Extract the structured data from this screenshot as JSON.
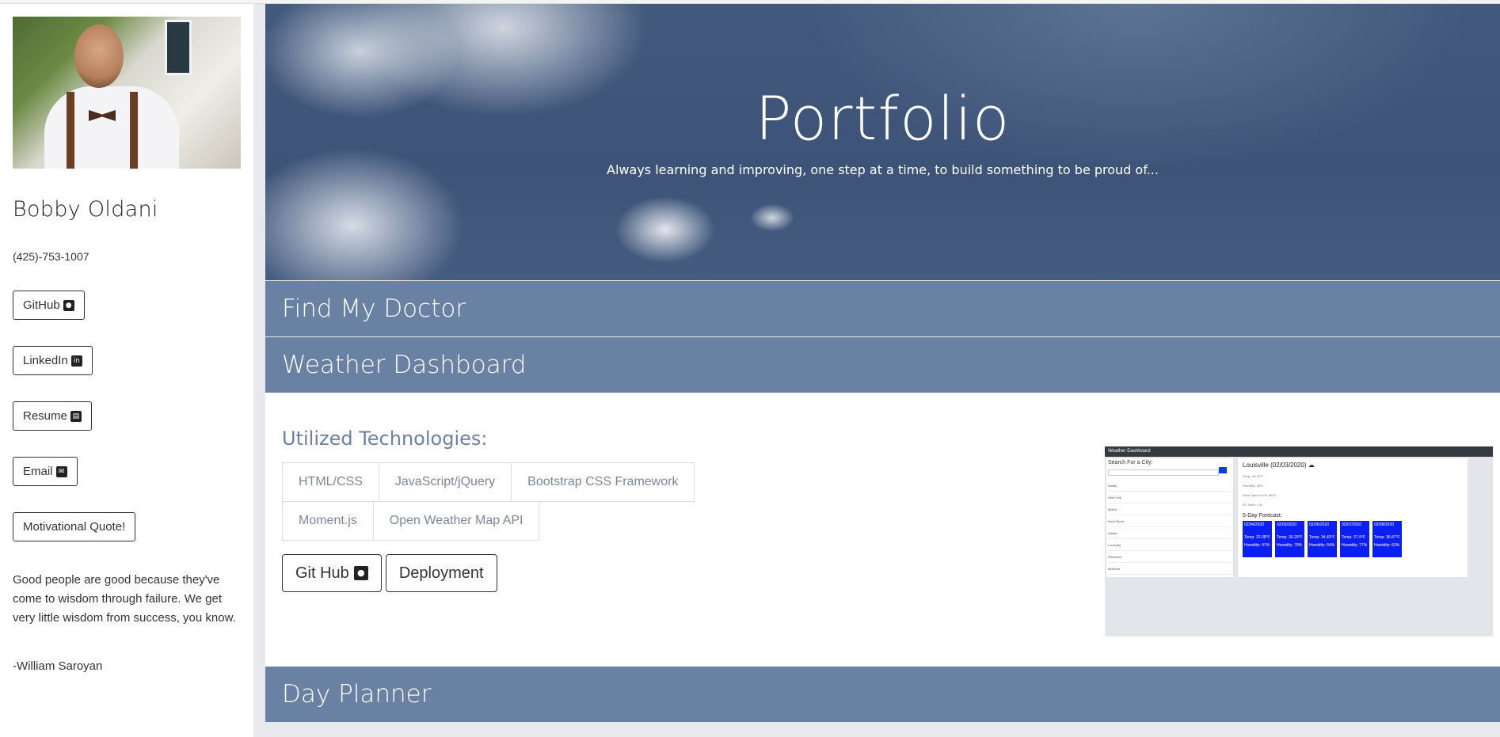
{
  "sidebar": {
    "name": "Bobby Oldani",
    "phone": "(425)-753-1007",
    "buttons": {
      "github": "GitHub",
      "linkedin": "LinkedIn",
      "resume": "Resume",
      "email": "Email",
      "quote": "Motivational Quote!"
    },
    "quote_text": "Good people are good because they've come to wisdom through failure. We get very little wisdom from success, you know.",
    "quote_author": "-William Saroyan"
  },
  "hero": {
    "title": "Portfolio",
    "subtitle": "Always learning and improving, one step at a time, to build something to be proud of..."
  },
  "projects": {
    "items": [
      {
        "label": "Find My Doctor"
      },
      {
        "label": "Weather Dashboard"
      },
      {
        "label": "Day Planner"
      }
    ],
    "open": {
      "tech_title": "Utilized Technologies:",
      "techs": [
        "HTML/CSS",
        "JavaScript/jQuery",
        "Bootstrap CSS Framework",
        "Moment.js",
        "Open Weather Map API"
      ],
      "github_label": "Git Hub",
      "deploy_label": "Deployment",
      "preview": {
        "bar_title": "Weather Dashboard",
        "search_label": "Search For a City:",
        "cities": [
          "Dallas",
          "New York",
          "Miami",
          "North Bend",
          "Dallas",
          "Louisville",
          "Redmond",
          "Bellevue"
        ],
        "current_title": "Louisville (02/03/2020) ☁",
        "lines": [
          "Temp: 45.93°F",
          "Humidity: 45%",
          "Wind Speed: 8.51 MPH",
          "UV Index: 1.8"
        ],
        "forecast_title": "5-Day Forecast:",
        "cards": [
          {
            "date": "02/04/2020",
            "temp": "Temp: 32.08°F",
            "hum": "Humidity: 97%"
          },
          {
            "date": "02/05/2020",
            "temp": "Temp: 36.29°F",
            "hum": "Humidity: 78%"
          },
          {
            "date": "02/06/2020",
            "temp": "Temp: 34.43°F",
            "hum": "Humidity: 64%"
          },
          {
            "date": "02/07/2020",
            "temp": "Temp: 27.9°F",
            "hum": "Humidity: 77%"
          },
          {
            "date": "02/08/2020",
            "temp": "Temp: 36.87°F",
            "hum": "Humidity: 63%"
          }
        ]
      }
    }
  },
  "icons": {
    "github": "github-icon",
    "linkedin": "linkedin-icon",
    "resume": "scroll-icon",
    "email": "envelope-icon"
  },
  "colors": {
    "accordion": "#6981a3",
    "tech_title": "#6981a3",
    "forecast_card": "#0b1ff5"
  }
}
